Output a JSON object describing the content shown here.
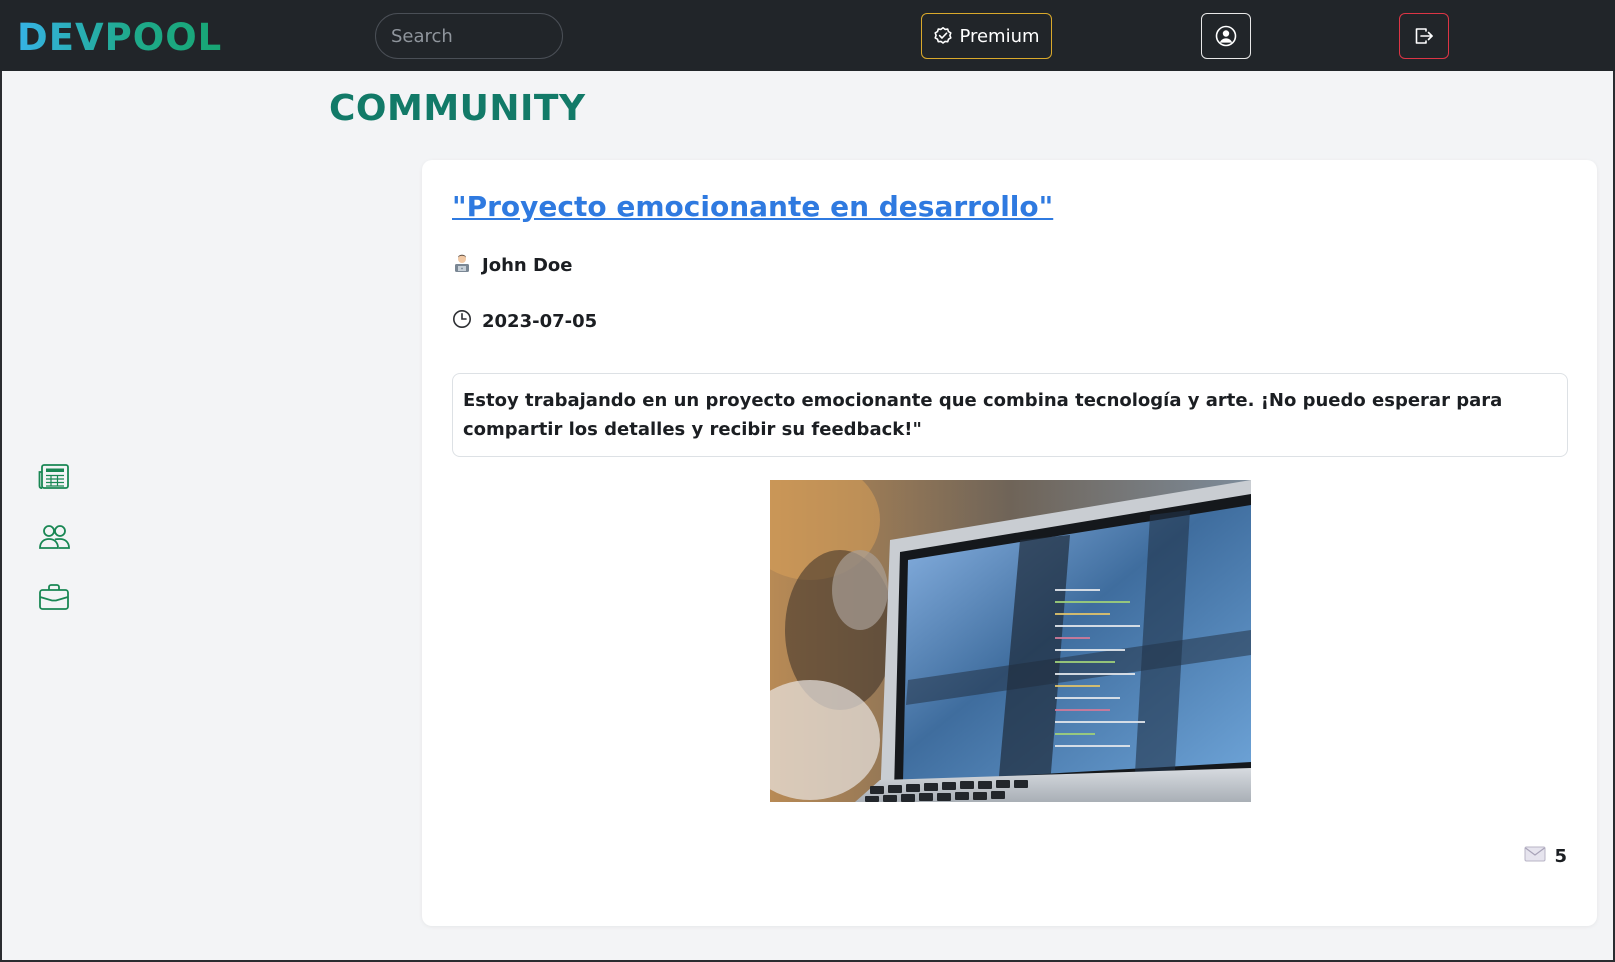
{
  "header": {
    "logo": "DEVPOOL",
    "search_placeholder": "Search",
    "premium_label": "Premium",
    "premium_icon": "check-badge-icon",
    "profile_icon": "user-circle-icon",
    "logout_icon": "logout-icon"
  },
  "sidebar": {
    "items": [
      {
        "icon": "newspaper-icon"
      },
      {
        "icon": "people-icon"
      },
      {
        "icon": "briefcase-icon"
      }
    ]
  },
  "main": {
    "title": "COMMUNITY",
    "post": {
      "title": "\"Proyecto emocionante en desarrollo\"",
      "author": "John Doe",
      "date": "2023-07-05",
      "content": "Estoy trabajando en un proyecto emocionante que combina tecnología y arte. ¡No puedo esperar para compartir los detalles y recibir su feedback!\"",
      "image_alt": "laptop with code on screen",
      "message_count": "5"
    }
  },
  "colors": {
    "navbar": "#212529",
    "accent_teal": "#127a68",
    "link_blue": "#2f7ae0",
    "premium_border": "#d9a92b",
    "logout_border": "#dc3545",
    "sidebar_icons": "#198754"
  }
}
